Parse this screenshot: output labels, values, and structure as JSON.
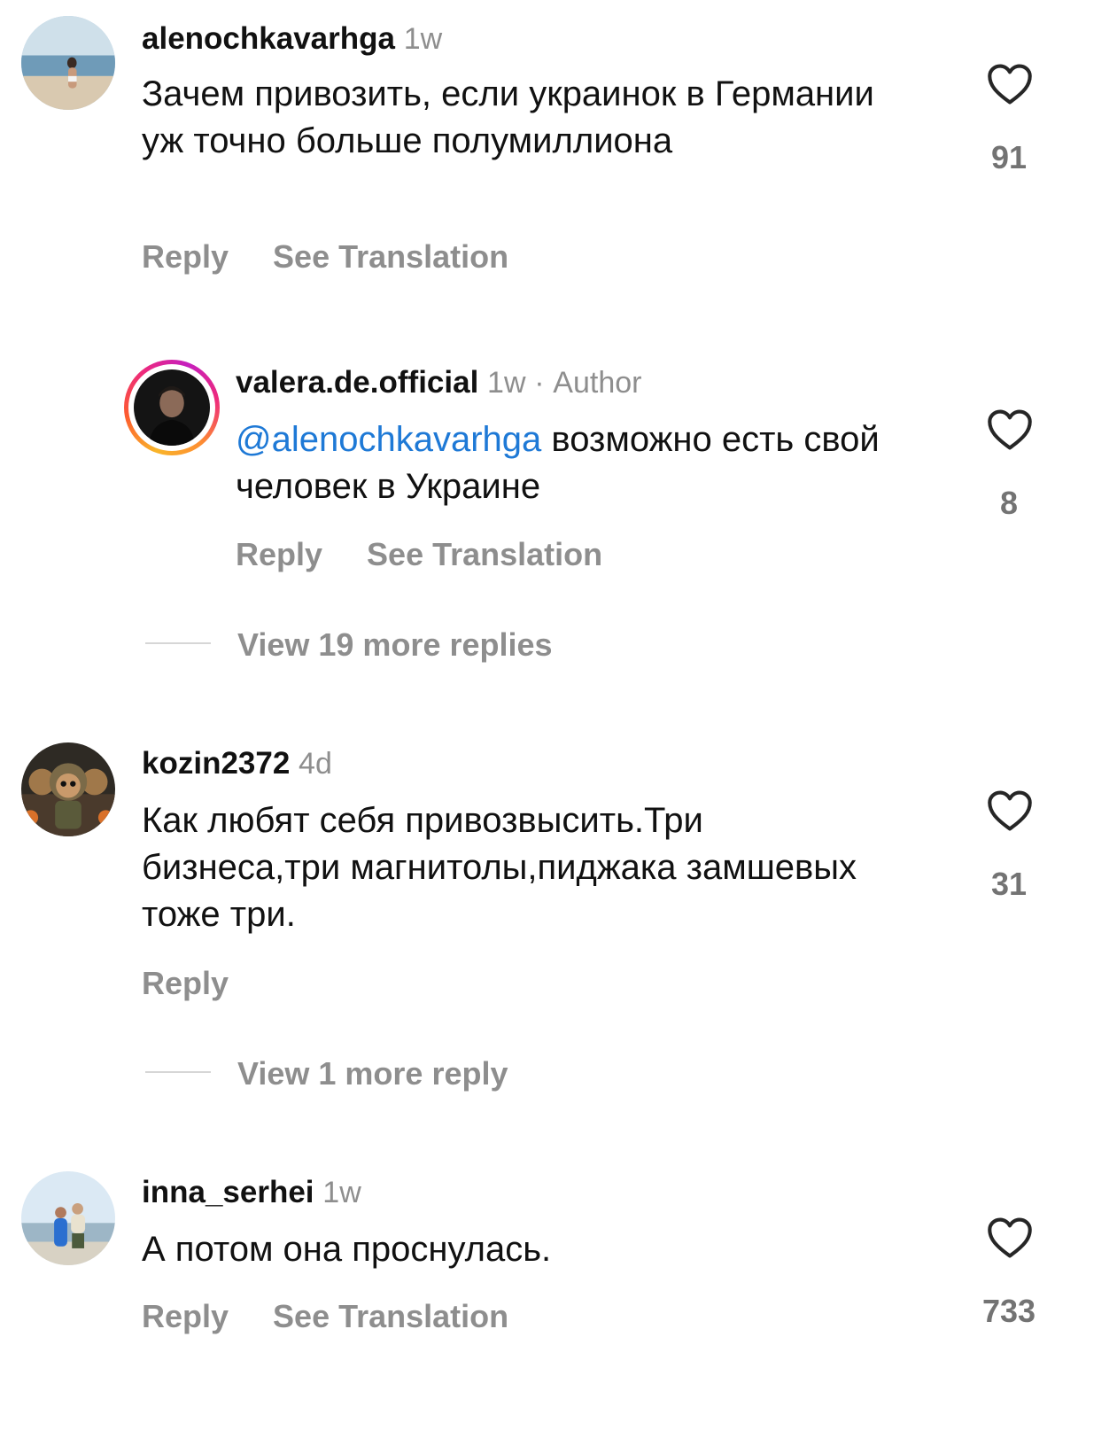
{
  "colors": {
    "mention": "#1e79d6",
    "secondary_text": "#8e8e8e",
    "primary_text": "#111111"
  },
  "comments": [
    {
      "username": "alenochkavarhga",
      "time": "1w",
      "text": "Зачем привозить, если украинок в Германии уж точно больше полумиллиона",
      "likes": "91",
      "reply_label": "Reply",
      "translate_label": "See Translation"
    },
    {
      "username": "kozin2372",
      "time": "4d",
      "text": "Как любят себя привозвысить.Три бизнеса,три магнитолы,пиджака замшевых тоже три.",
      "likes": "31",
      "reply_label": "Reply",
      "view_more": "View 1 more reply"
    },
    {
      "username": "inna_serhei",
      "time": "1w",
      "text": "А потом она проснулась.",
      "likes": "733",
      "reply_label": "Reply",
      "translate_label": "See Translation"
    }
  ],
  "reply": {
    "username": "valera.de.official",
    "time": "1w",
    "separator": "·",
    "badge": "Author",
    "mention": "@alenochkavarhga",
    "text": " возможно есть свой человек в Украине",
    "likes": "8",
    "reply_label": "Reply",
    "translate_label": "See Translation",
    "view_more": "View 19 more replies"
  },
  "icons": {
    "like": "heart-outline-icon"
  }
}
